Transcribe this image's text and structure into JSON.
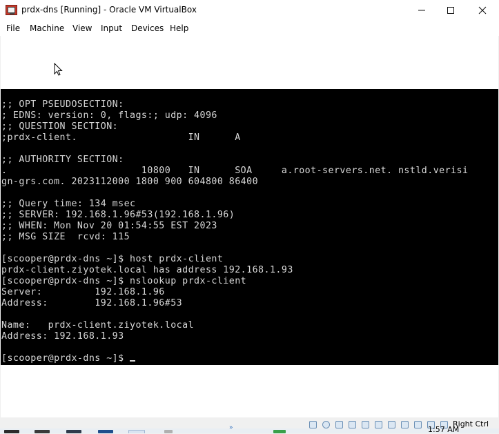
{
  "window": {
    "title": "prdx-dns [Running] - Oracle VM VirtualBox"
  },
  "menu": {
    "items": [
      "File",
      "Machine",
      "View",
      "Input",
      "Devices",
      "Help"
    ]
  },
  "terminal": {
    "lines": [
      ";; OPT PSEUDOSECTION:",
      "; EDNS: version: 0, flags:; udp: 4096",
      ";; QUESTION SECTION:",
      ";prdx-client.                   IN      A",
      "",
      ";; AUTHORITY SECTION:",
      ".                       10800   IN      SOA     a.root-servers.net. nstld.verisi",
      "gn-grs.com. 2023112000 1800 900 604800 86400",
      "",
      ";; Query time: 134 msec",
      ";; SERVER: 192.168.1.96#53(192.168.1.96)",
      ";; WHEN: Mon Nov 20 01:54:55 EST 2023",
      ";; MSG SIZE  rcvd: 115",
      "",
      "[scooper@prdx-dns ~]$ host prdx-client",
      "prdx-client.ziyotek.local has address 192.168.1.93",
      "[scooper@prdx-dns ~]$ nslookup prdx-client",
      "Server:         192.168.1.96",
      "Address:        192.168.1.96#53",
      "",
      "Name:   prdx-client.ziyotek.local",
      "Address: 192.168.1.93",
      "",
      "[scooper@prdx-dns ~]$ "
    ]
  },
  "statusbar": {
    "host_key": "Right Ctrl"
  },
  "taskbar": {
    "clock_time": "1:57 AM"
  },
  "icons": {
    "app": "virtualbox-icon",
    "minimize": "minimize-icon",
    "maximize": "maximize-icon",
    "close": "close-icon",
    "pointer": "mouse-pointer-icon"
  }
}
